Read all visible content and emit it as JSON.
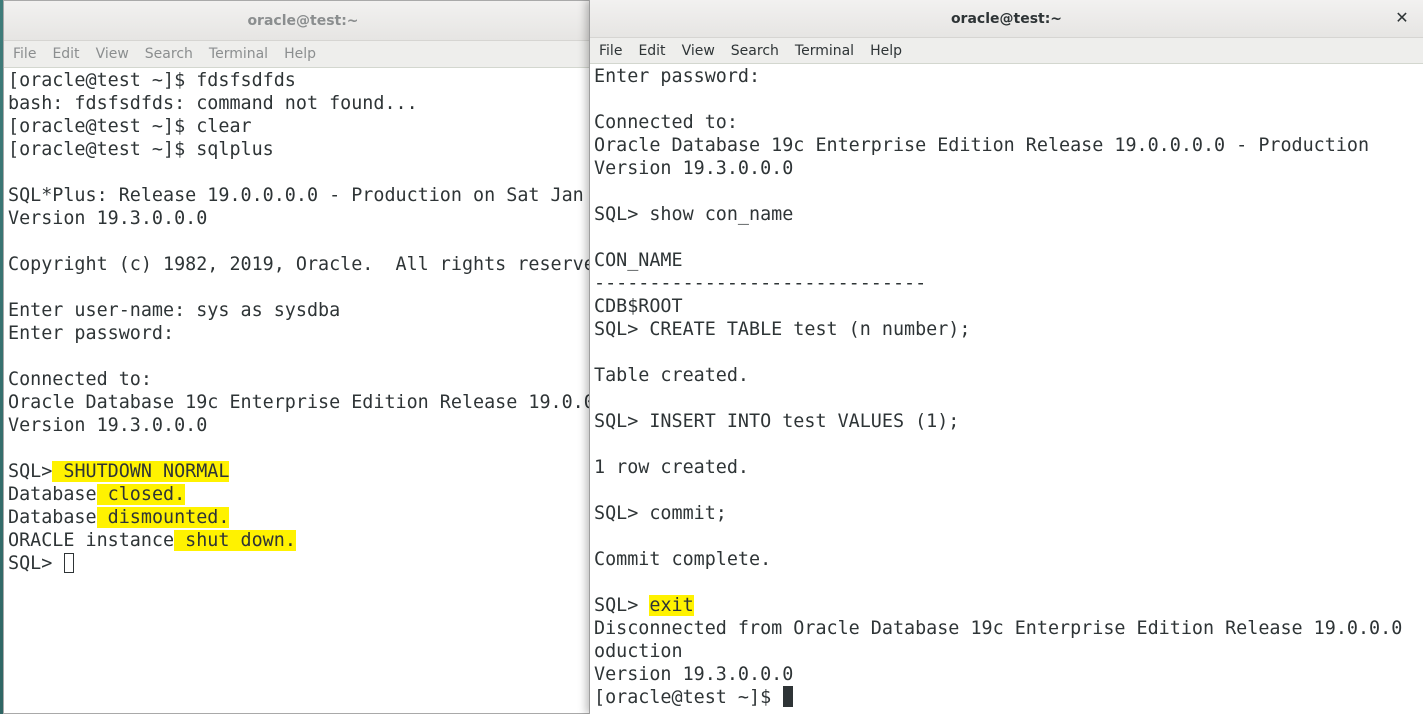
{
  "left_window": {
    "title": "oracle@test:~",
    "menu": [
      "File",
      "Edit",
      "View",
      "Search",
      "Terminal",
      "Help"
    ],
    "lines": [
      [
        {
          "t": "[oracle@test ~]$ fdsfsdfds"
        }
      ],
      [
        {
          "t": "bash: fdsfsdfds: command not found..."
        }
      ],
      [
        {
          "t": "[oracle@test ~]$ clear"
        }
      ],
      [
        {
          "t": "[oracle@test ~]$ sqlplus"
        }
      ],
      [
        {
          "t": ""
        }
      ],
      [
        {
          "t": "SQL*Plus: Release 19.0.0.0.0 - Production on Sat Jan"
        }
      ],
      [
        {
          "t": "Version 19.3.0.0.0"
        }
      ],
      [
        {
          "t": ""
        }
      ],
      [
        {
          "t": "Copyright (c) 1982, 2019, Oracle.  All rights reserve"
        }
      ],
      [
        {
          "t": ""
        }
      ],
      [
        {
          "t": "Enter user-name: sys as sysdba"
        }
      ],
      [
        {
          "t": "Enter password:"
        }
      ],
      [
        {
          "t": ""
        }
      ],
      [
        {
          "t": "Connected to:"
        }
      ],
      [
        {
          "t": "Oracle Database 19c Enterprise Edition Release 19.0.0"
        }
      ],
      [
        {
          "t": "Version 19.3.0.0.0"
        }
      ],
      [
        {
          "t": ""
        }
      ],
      [
        {
          "t": "SQL>"
        },
        {
          "t": " SHUTDOWN NORMAL",
          "hl": true
        }
      ],
      [
        {
          "t": "Database"
        },
        {
          "t": " closed.",
          "hl": true
        }
      ],
      [
        {
          "t": "Database"
        },
        {
          "t": " dismounted.",
          "hl": true
        }
      ],
      [
        {
          "t": "ORACLE instance"
        },
        {
          "t": " shut down.",
          "hl": true
        }
      ],
      [
        {
          "t": "SQL> "
        },
        {
          "cursor": "hollow"
        }
      ]
    ]
  },
  "right_window": {
    "title": "oracle@test:~",
    "close_icon": "close-icon",
    "menu": [
      "File",
      "Edit",
      "View",
      "Search",
      "Terminal",
      "Help"
    ],
    "lines": [
      [
        {
          "t": "Enter password:"
        }
      ],
      [
        {
          "t": ""
        }
      ],
      [
        {
          "t": "Connected to:"
        }
      ],
      [
        {
          "t": "Oracle Database 19c Enterprise Edition Release 19.0.0.0.0 - Production"
        }
      ],
      [
        {
          "t": "Version 19.3.0.0.0"
        }
      ],
      [
        {
          "t": ""
        }
      ],
      [
        {
          "t": "SQL> show con_name"
        }
      ],
      [
        {
          "t": ""
        }
      ],
      [
        {
          "t": "CON_NAME"
        }
      ],
      [
        {
          "t": "------------------------------"
        }
      ],
      [
        {
          "t": "CDB$ROOT"
        }
      ],
      [
        {
          "t": "SQL> CREATE TABLE test (n number);"
        }
      ],
      [
        {
          "t": ""
        }
      ],
      [
        {
          "t": "Table created."
        }
      ],
      [
        {
          "t": ""
        }
      ],
      [
        {
          "t": "SQL> INSERT INTO test VALUES (1);"
        }
      ],
      [
        {
          "t": ""
        }
      ],
      [
        {
          "t": "1 row created."
        }
      ],
      [
        {
          "t": ""
        }
      ],
      [
        {
          "t": "SQL> commit;"
        }
      ],
      [
        {
          "t": ""
        }
      ],
      [
        {
          "t": "Commit complete."
        }
      ],
      [
        {
          "t": ""
        }
      ],
      [
        {
          "t": "SQL> "
        },
        {
          "t": "exit",
          "hl": true
        }
      ],
      [
        {
          "t": "Disconnected from Oracle Database 19c Enterprise Edition Release 19.0.0.0"
        }
      ],
      [
        {
          "t": "oduction"
        }
      ],
      [
        {
          "t": "Version 19.3.0.0.0"
        }
      ],
      [
        {
          "t": "[oracle@test ~]$ "
        },
        {
          "cursor": "solid"
        }
      ]
    ]
  },
  "colors": {
    "highlight": "#fff200",
    "terminal_text": "#2e3436",
    "terminal_bg": "#ffffff"
  }
}
